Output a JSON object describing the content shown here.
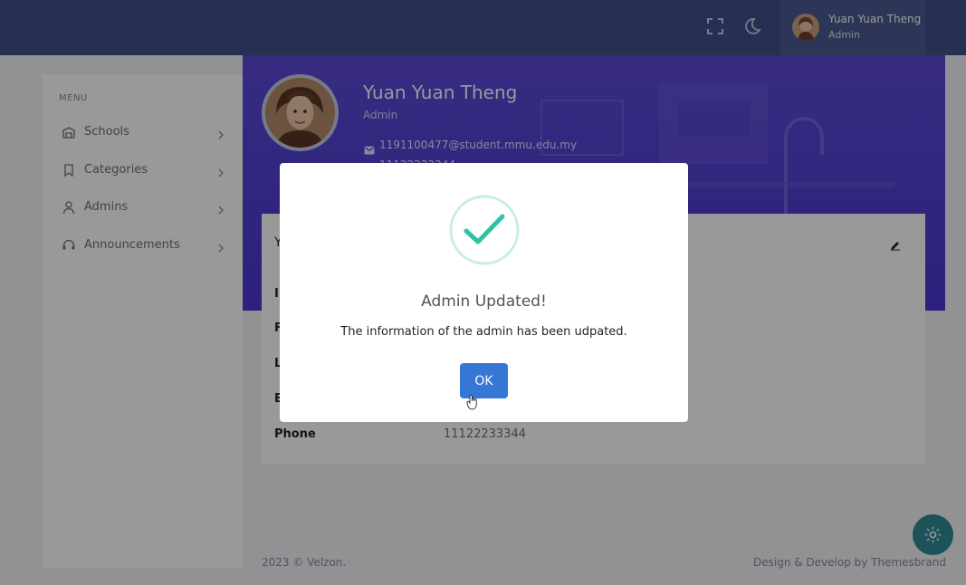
{
  "topbar": {
    "fullscreen_icon": "fullscreen-icon",
    "theme_icon": "moon-icon",
    "user": {
      "name": "Yuan Yuan Theng",
      "role": "Admin"
    }
  },
  "sidebar": {
    "menu_title": "MENU",
    "items": [
      {
        "label": "Schools",
        "icon": "school-icon"
      },
      {
        "label": "Categories",
        "icon": "bookmark-icon"
      },
      {
        "label": "Admins",
        "icon": "user-icon"
      },
      {
        "label": "Announcements",
        "icon": "headset-icon"
      }
    ]
  },
  "profile": {
    "name": "Yuan Yuan Theng",
    "role": "Admin",
    "email": "1191100477@student.mmu.edu.my",
    "phone": "11122233344"
  },
  "info_card": {
    "title": "Y",
    "rows": [
      {
        "label": "I",
        "value": ""
      },
      {
        "label": "F",
        "value": ""
      },
      {
        "label": "L",
        "value": ""
      },
      {
        "label": "E",
        "value": ""
      },
      {
        "label": "Phone",
        "value": "11122233344"
      }
    ]
  },
  "footer": {
    "left": "2023 © Velzon.",
    "right": "Design & Develop by Themesbrand"
  },
  "modal": {
    "title": "Admin Updated!",
    "text": "The information of the admin has been udpated.",
    "ok_label": "OK"
  },
  "colors": {
    "topbar": "#405189",
    "banner": "#5b4ad6",
    "success": "#2fc3a4",
    "ok_button": "#3577d4",
    "fab": "#2f8a95"
  }
}
